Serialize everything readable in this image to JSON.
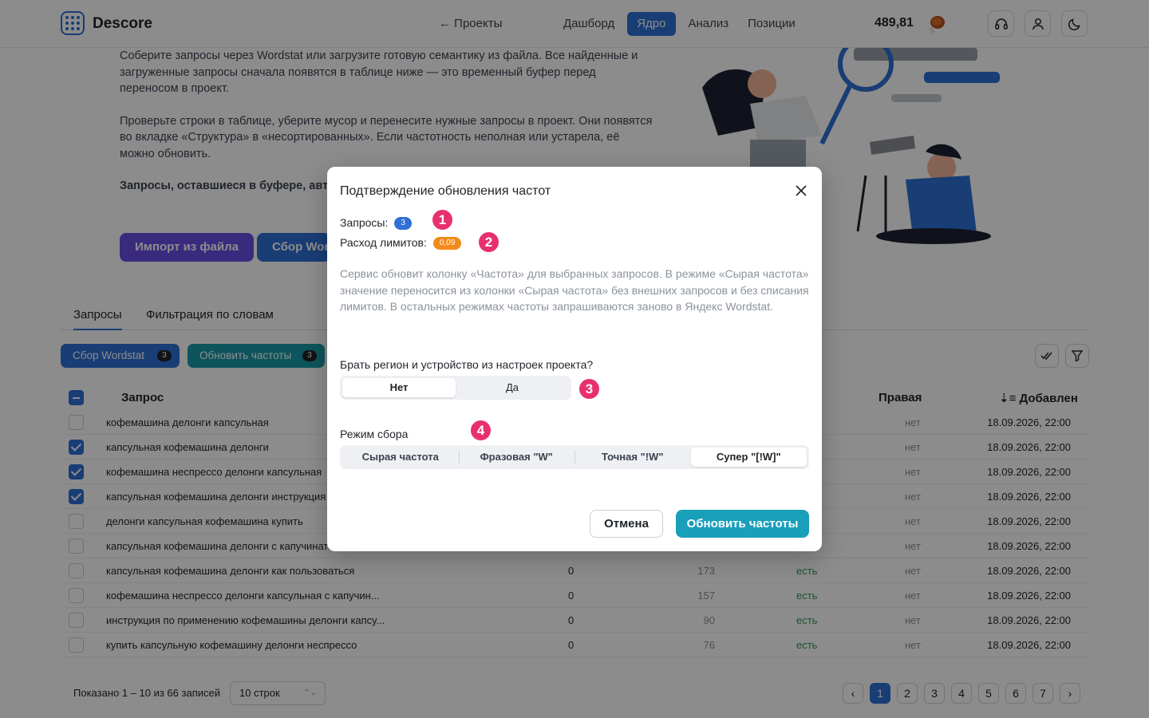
{
  "header": {
    "brand": "Descore",
    "back_link": "← Проекты",
    "nav": [
      "Дашборд",
      "Ядро",
      "Анализ",
      "Позиции"
    ],
    "nav_active": "Ядро",
    "balance": "489,81"
  },
  "intro": {
    "p1": "Соберите запросы через Wordstat или загрузите готовую семантику из файла. Все найденные и загруженные запросы сначала появятся в таблице ниже — это временный буфер перед переносом в проект.",
    "p2": "Проверьте строки в таблице, уберите мусор и перенесите нужные запросы в проект. Они появятся во вкладке «Структура» в «несортированных». Если частотность неполная или устарела, её можно обновить.",
    "p3": "Запросы, оставшиеся в буфере, авто"
  },
  "actions": {
    "import": "Импорт из файла",
    "collect": "Сбор Wordstat"
  },
  "tabs": [
    "Запросы",
    "Фильтрация по словам"
  ],
  "toolbar": {
    "chip1": "Сбор Wordstat",
    "chip1_count": "3",
    "chip2": "Обновить частоты",
    "chip2_count": "3"
  },
  "table": {
    "headers": {
      "query": "Запрос",
      "right": "Правая",
      "added": "Добавлен"
    },
    "rows": [
      {
        "checked": false,
        "query": "кофемашина делонги капсульная",
        "c1": "",
        "c2": "",
        "c3": "",
        "c4": "нет",
        "date": "18.09.2026, 22:00"
      },
      {
        "checked": true,
        "query": "капсульная кофемашина делонги",
        "c1": "",
        "c2": "",
        "c3": "",
        "c4": "нет",
        "date": "18.09.2026, 22:00"
      },
      {
        "checked": true,
        "query": "кофемашина неспрессо делонги капсульная",
        "c1": "",
        "c2": "",
        "c3": "",
        "c4": "нет",
        "date": "18.09.2026, 22:00"
      },
      {
        "checked": true,
        "query": "капсульная кофемашина делонги инструкция",
        "c1": "",
        "c2": "",
        "c3": "",
        "c4": "нет",
        "date": "18.09.2026, 22:00"
      },
      {
        "checked": false,
        "query": "делонги капсульная кофемашина купить",
        "c1": "",
        "c2": "",
        "c3": "",
        "c4": "нет",
        "date": "18.09.2026, 22:00"
      },
      {
        "checked": false,
        "query": "капсульная кофемашина делонги с капучинато",
        "c1": "",
        "c2": "",
        "c3": "",
        "c4": "нет",
        "date": "18.09.2026, 22:00"
      },
      {
        "checked": false,
        "query": "капсульная кофемашина делонги как пользоваться",
        "c1": "0",
        "c2": "173",
        "c3": "есть",
        "c4": "нет",
        "date": "18.09.2026, 22:00"
      },
      {
        "checked": false,
        "query": "кофемашина неспрессо делонги капсульная с капучин...",
        "c1": "0",
        "c2": "157",
        "c3": "есть",
        "c4": "нет",
        "date": "18.09.2026, 22:00"
      },
      {
        "checked": false,
        "query": "инструкция по применению кофемашины делонги капсу...",
        "c1": "0",
        "c2": "90",
        "c3": "есть",
        "c4": "нет",
        "date": "18.09.2026, 22:00"
      },
      {
        "checked": false,
        "query": "купить капсульную кофемашину делонги неспрессо",
        "c1": "0",
        "c2": "76",
        "c3": "есть",
        "c4": "нет",
        "date": "18.09.2026, 22:00"
      }
    ]
  },
  "footer": {
    "info": "Показано 1 – 10 из 66 записей",
    "rows_select": "10 строк",
    "pages": [
      "1",
      "2",
      "3",
      "4",
      "5",
      "6",
      "7"
    ],
    "prev": "‹",
    "next": "›"
  },
  "modal": {
    "title": "Подтверждение обновления частот",
    "queries_label": "Запросы:",
    "queries_count": "3",
    "limits_label": "Расход лимитов:",
    "limits_value": "0,09",
    "description": "Сервис обновит колонку «Частота» для выбранных запросов. В режиме «Сырая частота» значение переносится из колонки «Сырая частота» без внешних запросов и без списания лимитов. В остальных режимах частоты запрашиваются заново в Яндекс Wordstat.",
    "region_question": "Брать регион и устройство из настроек проекта?",
    "region_options": [
      "Нет",
      "Да"
    ],
    "mode_label": "Режим сбора",
    "mode_options": [
      "Сырая частота",
      "Фразовая \"W\"",
      "Точная \"!W\"",
      "Супер \"[!W]\""
    ],
    "cancel": "Отмена",
    "confirm": "Обновить частоты",
    "markers": [
      "1",
      "2",
      "3",
      "4"
    ]
  },
  "colors": {
    "accent": "#2f6fd6",
    "primary_button": "#1a9fba",
    "import_button": "#6b4ee6",
    "chip_teal": "#1b9aa8",
    "marker": "#e8306d",
    "limits_pill": "#f28a1a"
  }
}
